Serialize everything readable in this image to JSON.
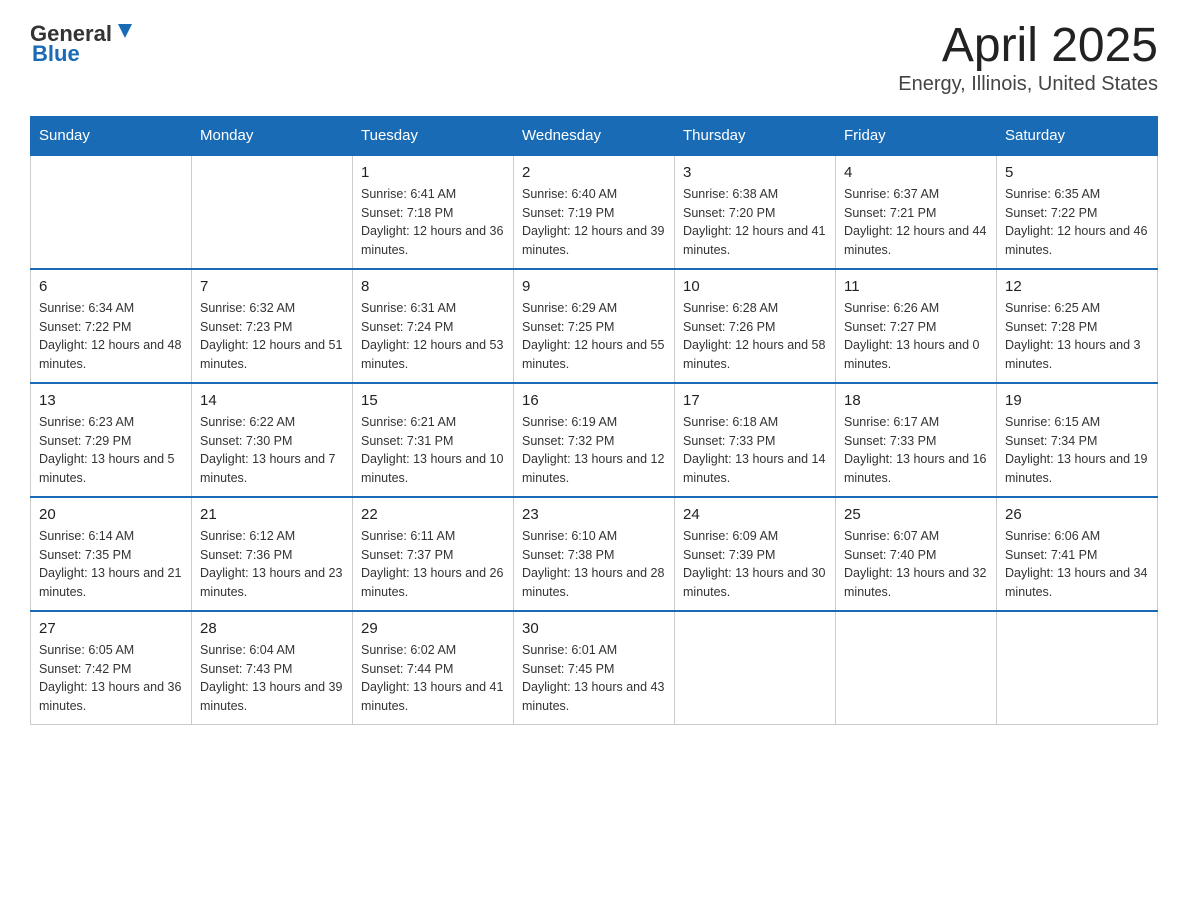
{
  "logo": {
    "general": "General",
    "blue": "Blue"
  },
  "title": "April 2025",
  "subtitle": "Energy, Illinois, United States",
  "days_header": [
    "Sunday",
    "Monday",
    "Tuesday",
    "Wednesday",
    "Thursday",
    "Friday",
    "Saturday"
  ],
  "weeks": [
    [
      {
        "day": "",
        "sunrise": "",
        "sunset": "",
        "daylight": ""
      },
      {
        "day": "",
        "sunrise": "",
        "sunset": "",
        "daylight": ""
      },
      {
        "day": "1",
        "sunrise": "Sunrise: 6:41 AM",
        "sunset": "Sunset: 7:18 PM",
        "daylight": "Daylight: 12 hours and 36 minutes."
      },
      {
        "day": "2",
        "sunrise": "Sunrise: 6:40 AM",
        "sunset": "Sunset: 7:19 PM",
        "daylight": "Daylight: 12 hours and 39 minutes."
      },
      {
        "day": "3",
        "sunrise": "Sunrise: 6:38 AM",
        "sunset": "Sunset: 7:20 PM",
        "daylight": "Daylight: 12 hours and 41 minutes."
      },
      {
        "day": "4",
        "sunrise": "Sunrise: 6:37 AM",
        "sunset": "Sunset: 7:21 PM",
        "daylight": "Daylight: 12 hours and 44 minutes."
      },
      {
        "day": "5",
        "sunrise": "Sunrise: 6:35 AM",
        "sunset": "Sunset: 7:22 PM",
        "daylight": "Daylight: 12 hours and 46 minutes."
      }
    ],
    [
      {
        "day": "6",
        "sunrise": "Sunrise: 6:34 AM",
        "sunset": "Sunset: 7:22 PM",
        "daylight": "Daylight: 12 hours and 48 minutes."
      },
      {
        "day": "7",
        "sunrise": "Sunrise: 6:32 AM",
        "sunset": "Sunset: 7:23 PM",
        "daylight": "Daylight: 12 hours and 51 minutes."
      },
      {
        "day": "8",
        "sunrise": "Sunrise: 6:31 AM",
        "sunset": "Sunset: 7:24 PM",
        "daylight": "Daylight: 12 hours and 53 minutes."
      },
      {
        "day": "9",
        "sunrise": "Sunrise: 6:29 AM",
        "sunset": "Sunset: 7:25 PM",
        "daylight": "Daylight: 12 hours and 55 minutes."
      },
      {
        "day": "10",
        "sunrise": "Sunrise: 6:28 AM",
        "sunset": "Sunset: 7:26 PM",
        "daylight": "Daylight: 12 hours and 58 minutes."
      },
      {
        "day": "11",
        "sunrise": "Sunrise: 6:26 AM",
        "sunset": "Sunset: 7:27 PM",
        "daylight": "Daylight: 13 hours and 0 minutes."
      },
      {
        "day": "12",
        "sunrise": "Sunrise: 6:25 AM",
        "sunset": "Sunset: 7:28 PM",
        "daylight": "Daylight: 13 hours and 3 minutes."
      }
    ],
    [
      {
        "day": "13",
        "sunrise": "Sunrise: 6:23 AM",
        "sunset": "Sunset: 7:29 PM",
        "daylight": "Daylight: 13 hours and 5 minutes."
      },
      {
        "day": "14",
        "sunrise": "Sunrise: 6:22 AM",
        "sunset": "Sunset: 7:30 PM",
        "daylight": "Daylight: 13 hours and 7 minutes."
      },
      {
        "day": "15",
        "sunrise": "Sunrise: 6:21 AM",
        "sunset": "Sunset: 7:31 PM",
        "daylight": "Daylight: 13 hours and 10 minutes."
      },
      {
        "day": "16",
        "sunrise": "Sunrise: 6:19 AM",
        "sunset": "Sunset: 7:32 PM",
        "daylight": "Daylight: 13 hours and 12 minutes."
      },
      {
        "day": "17",
        "sunrise": "Sunrise: 6:18 AM",
        "sunset": "Sunset: 7:33 PM",
        "daylight": "Daylight: 13 hours and 14 minutes."
      },
      {
        "day": "18",
        "sunrise": "Sunrise: 6:17 AM",
        "sunset": "Sunset: 7:33 PM",
        "daylight": "Daylight: 13 hours and 16 minutes."
      },
      {
        "day": "19",
        "sunrise": "Sunrise: 6:15 AM",
        "sunset": "Sunset: 7:34 PM",
        "daylight": "Daylight: 13 hours and 19 minutes."
      }
    ],
    [
      {
        "day": "20",
        "sunrise": "Sunrise: 6:14 AM",
        "sunset": "Sunset: 7:35 PM",
        "daylight": "Daylight: 13 hours and 21 minutes."
      },
      {
        "day": "21",
        "sunrise": "Sunrise: 6:12 AM",
        "sunset": "Sunset: 7:36 PM",
        "daylight": "Daylight: 13 hours and 23 minutes."
      },
      {
        "day": "22",
        "sunrise": "Sunrise: 6:11 AM",
        "sunset": "Sunset: 7:37 PM",
        "daylight": "Daylight: 13 hours and 26 minutes."
      },
      {
        "day": "23",
        "sunrise": "Sunrise: 6:10 AM",
        "sunset": "Sunset: 7:38 PM",
        "daylight": "Daylight: 13 hours and 28 minutes."
      },
      {
        "day": "24",
        "sunrise": "Sunrise: 6:09 AM",
        "sunset": "Sunset: 7:39 PM",
        "daylight": "Daylight: 13 hours and 30 minutes."
      },
      {
        "day": "25",
        "sunrise": "Sunrise: 6:07 AM",
        "sunset": "Sunset: 7:40 PM",
        "daylight": "Daylight: 13 hours and 32 minutes."
      },
      {
        "day": "26",
        "sunrise": "Sunrise: 6:06 AM",
        "sunset": "Sunset: 7:41 PM",
        "daylight": "Daylight: 13 hours and 34 minutes."
      }
    ],
    [
      {
        "day": "27",
        "sunrise": "Sunrise: 6:05 AM",
        "sunset": "Sunset: 7:42 PM",
        "daylight": "Daylight: 13 hours and 36 minutes."
      },
      {
        "day": "28",
        "sunrise": "Sunrise: 6:04 AM",
        "sunset": "Sunset: 7:43 PM",
        "daylight": "Daylight: 13 hours and 39 minutes."
      },
      {
        "day": "29",
        "sunrise": "Sunrise: 6:02 AM",
        "sunset": "Sunset: 7:44 PM",
        "daylight": "Daylight: 13 hours and 41 minutes."
      },
      {
        "day": "30",
        "sunrise": "Sunrise: 6:01 AM",
        "sunset": "Sunset: 7:45 PM",
        "daylight": "Daylight: 13 hours and 43 minutes."
      },
      {
        "day": "",
        "sunrise": "",
        "sunset": "",
        "daylight": ""
      },
      {
        "day": "",
        "sunrise": "",
        "sunset": "",
        "daylight": ""
      },
      {
        "day": "",
        "sunrise": "",
        "sunset": "",
        "daylight": ""
      }
    ]
  ]
}
